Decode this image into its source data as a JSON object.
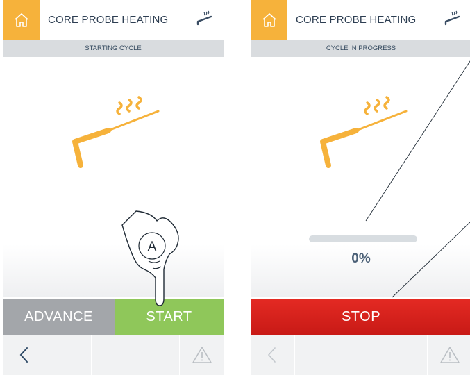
{
  "left_screen": {
    "header": {
      "title": "CORE PROBE HEATING"
    },
    "subheader": "STARTING CYCLE",
    "advance_label": "ADVANCE",
    "start_label": "START",
    "callout_marker": "A"
  },
  "right_screen": {
    "header": {
      "title": "CORE PROBE HEATING"
    },
    "subheader": "CYCLE IN PROGRESS",
    "progress": {
      "percent": 0,
      "label": "0%"
    },
    "stop_label": "STOP"
  },
  "icons": {
    "home": "home-icon",
    "probe": "core-probe-icon",
    "back": "chevron-left-icon",
    "warning": "warning-icon"
  },
  "colors": {
    "accent_orange": "#f6b23b",
    "start_green": "#8fc75a",
    "advance_grey": "#a3a6aa",
    "stop_red": "#d9221d"
  }
}
